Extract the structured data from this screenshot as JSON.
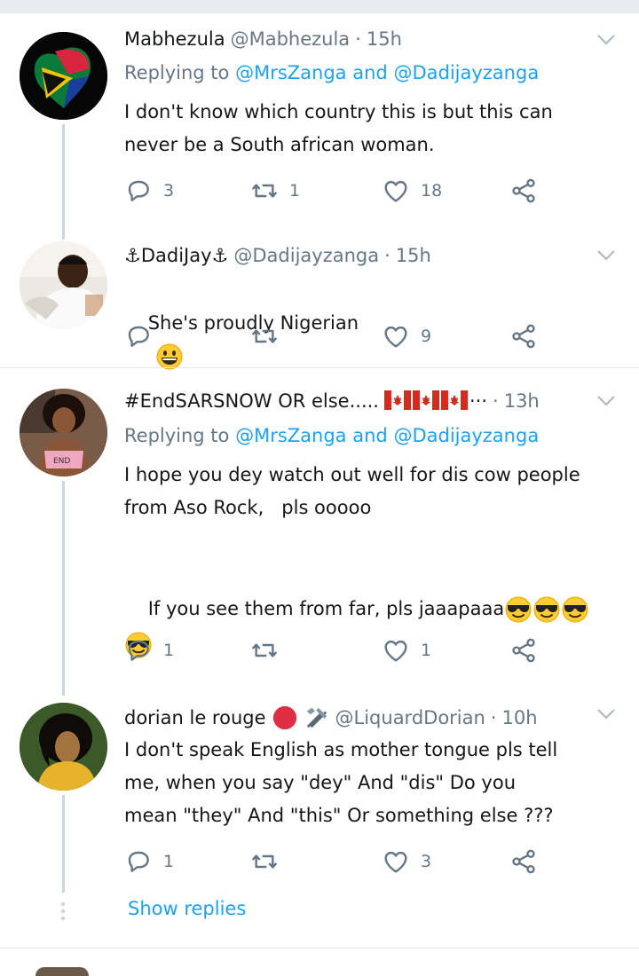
{
  "replies": [
    {
      "name": "Mabhezula",
      "handle": "@Mabhezula",
      "time": "15h",
      "replying_label": "Replying to",
      "replying_to_1": "@MrsZanga",
      "replying_and": "and",
      "replying_to_2": "@Dadijayzanga",
      "text": "I don't know which country this is but this can\nnever be a South african woman.",
      "reply_count": "3",
      "retweet_count": "1",
      "like_count": "18"
    },
    {
      "name": "⚓DadiJay⚓",
      "handle": "@Dadijayzanga",
      "time": "15h",
      "text": "She's proudly Nigerian",
      "reply_count": "",
      "retweet_count": "",
      "like_count": "9"
    },
    {
      "name": "#EndSARSNOW OR else.....",
      "name_suffix": "···",
      "time": "13h",
      "replying_label": "Replying to",
      "replying_to_1": "@MrsZanga",
      "replying_and": "and",
      "replying_to_2": "@Dadijayzanga",
      "text_1": "I hope you dey watch out well for dis cow people\nfrom Aso Rock,   pls ooooo",
      "text_2": "If you see them from far, pls jaaapaaa",
      "reply_count": "1",
      "retweet_count": "",
      "like_count": "1"
    },
    {
      "name": "dorian le rouge",
      "handle": "@LiquardDorian",
      "time": "10h",
      "text": "I don't speak English as mother tongue pls tell\nme, when you say \"dey\" And \"dis\" Do you\nmean \"they\" And \"this\" Or something else ???",
      "reply_count": "1",
      "retweet_count": "",
      "like_count": "3"
    }
  ],
  "show_replies": "Show replies",
  "dot": "·",
  "colors": {
    "link": "#1da1f2",
    "muted": "#657786",
    "border": "#e1e8ed"
  }
}
